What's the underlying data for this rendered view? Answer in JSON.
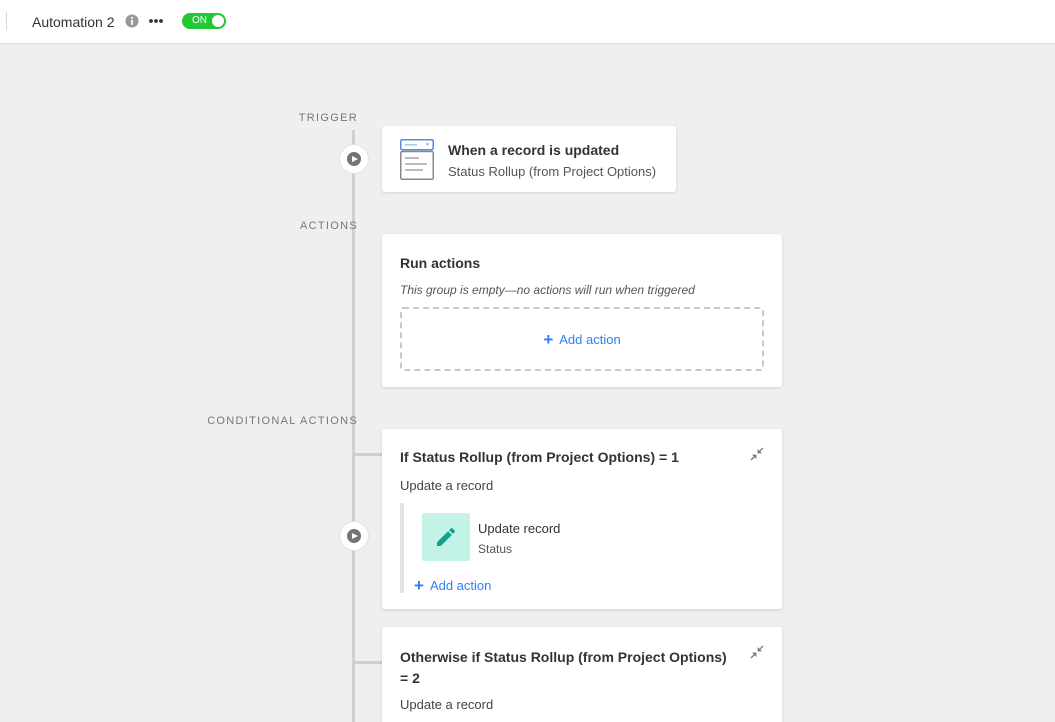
{
  "header": {
    "automation_name": "Automation 2",
    "toggle_label": "ON",
    "toggle_color": "#20c933"
  },
  "icons": {
    "info": "info-circle-icon",
    "more": "more-dots-icon",
    "play": "play-icon",
    "collapse": "collapse-arrows-icon",
    "edit": "pencil-icon",
    "trigger": "record-form-icon"
  },
  "trigger": {
    "section_label": "TRIGGER",
    "title": "When a record is updated",
    "subtitle": "Status Rollup (from Project Options)"
  },
  "actions": {
    "section_label": "ACTIONS",
    "title": "Run actions",
    "empty_text": "This group is empty—no actions will run when triggered",
    "add_action": "Add action"
  },
  "conditional": {
    "section_label": "CONDITIONAL ACTIONS",
    "groups": [
      {
        "title": "If Status Rollup (from Project Options) = 1",
        "subtitle": "Update a record",
        "action_title": "Update record",
        "action_field": "Status",
        "add_action": "Add action"
      },
      {
        "title_line1": "Otherwise if Status Rollup (from Project Options)",
        "title_line2": "= 2",
        "subtitle": "Update a record"
      }
    ]
  },
  "colors": {
    "accent": "#2d7ff9",
    "edit_tile": "#c3f2e6",
    "edit_icon": "#0fa38e",
    "background": "#efefef"
  }
}
